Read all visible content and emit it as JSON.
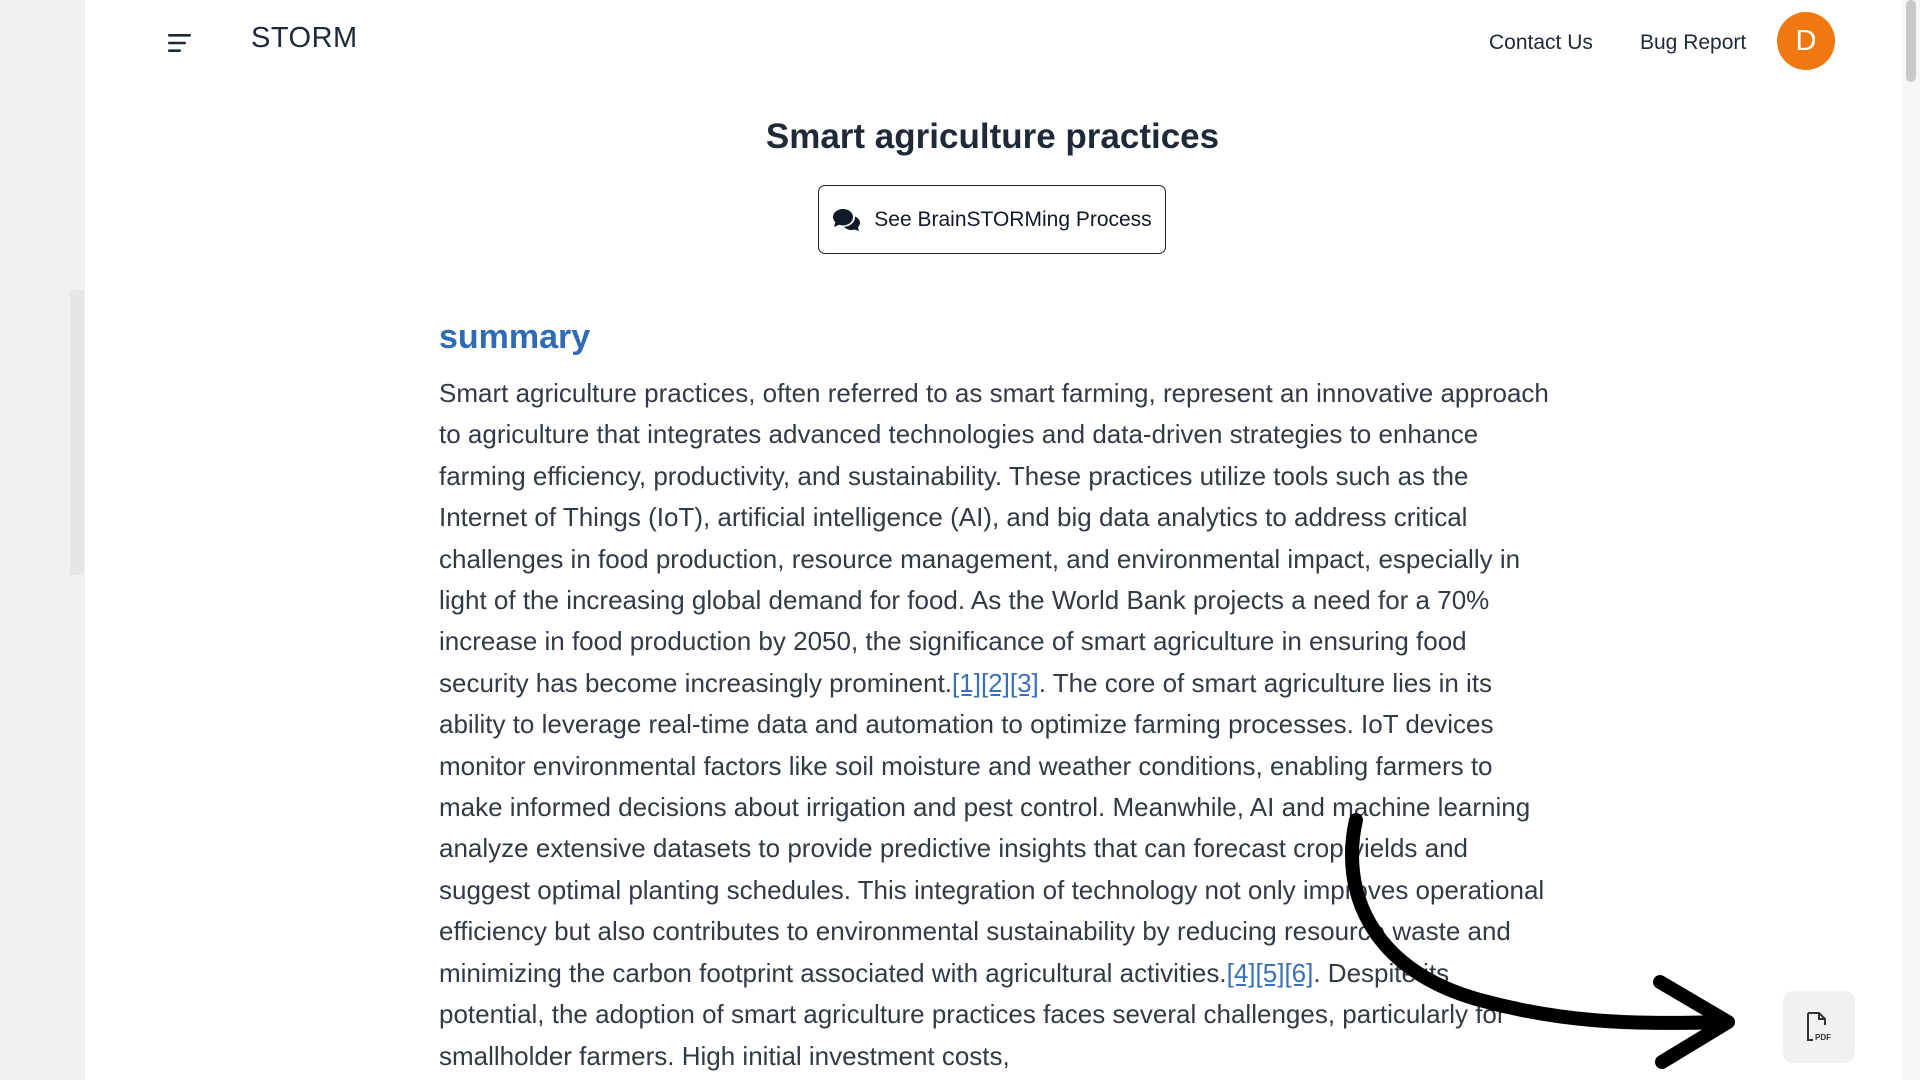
{
  "header": {
    "brand": "STORM",
    "nav": {
      "contact": "Contact Us",
      "bug_report": "Bug Report"
    },
    "avatar_initial": "D",
    "avatar_color": "#f07811"
  },
  "article": {
    "title": "Smart agriculture practices",
    "brainstorm_button": "See BrainSTORMing Process",
    "section_heading": "summary",
    "accent_color": "#2f6bb5",
    "para1": "Smart agriculture practices, often referred to as smart farming, represent an innovative approach to agriculture that integrates advanced technologies and data-driven strategies to enhance farming efficiency, productivity, and sustainability. These practices utilize tools such as the Internet of Things (IoT), artificial intelligence (AI), and big data analytics to address critical challenges in food production, resource management, and environmental impact, especially in light of the increasing global demand for food. As the World Bank projects a need for a 70% increase in food production by 2050, the significance of smart agriculture in ensuring food security has become increasingly prominent.",
    "cites1": [
      "[1]",
      "[2]",
      "[3]"
    ],
    "para2": ". The core of smart agriculture lies in its ability to leverage real-time data and automation to optimize farming processes. IoT devices monitor environmental factors like soil moisture and weather conditions, enabling farmers to make informed decisions about irrigation and pest control. Meanwhile, AI and machine learning analyze extensive datasets to provide predictive insights that can forecast crop yields and suggest optimal planting schedules. This integration of technology not only improves operational efficiency but also contributes to environmental sustainability by reducing resource waste and minimizing the carbon footprint associated with agricultural activities.",
    "cites2": [
      "[4]",
      "[5]",
      "[6]"
    ],
    "para3": ". Despite its potential, the adoption of smart agriculture practices faces several challenges, particularly for smallholder farmers. High initial investment costs,"
  },
  "icons": {
    "menu": "menu-lines-icon",
    "brainstorm": "chat-bubbles-icon",
    "pdf": "pdf-file-icon",
    "arrow": "curved-arrow-annotation"
  }
}
